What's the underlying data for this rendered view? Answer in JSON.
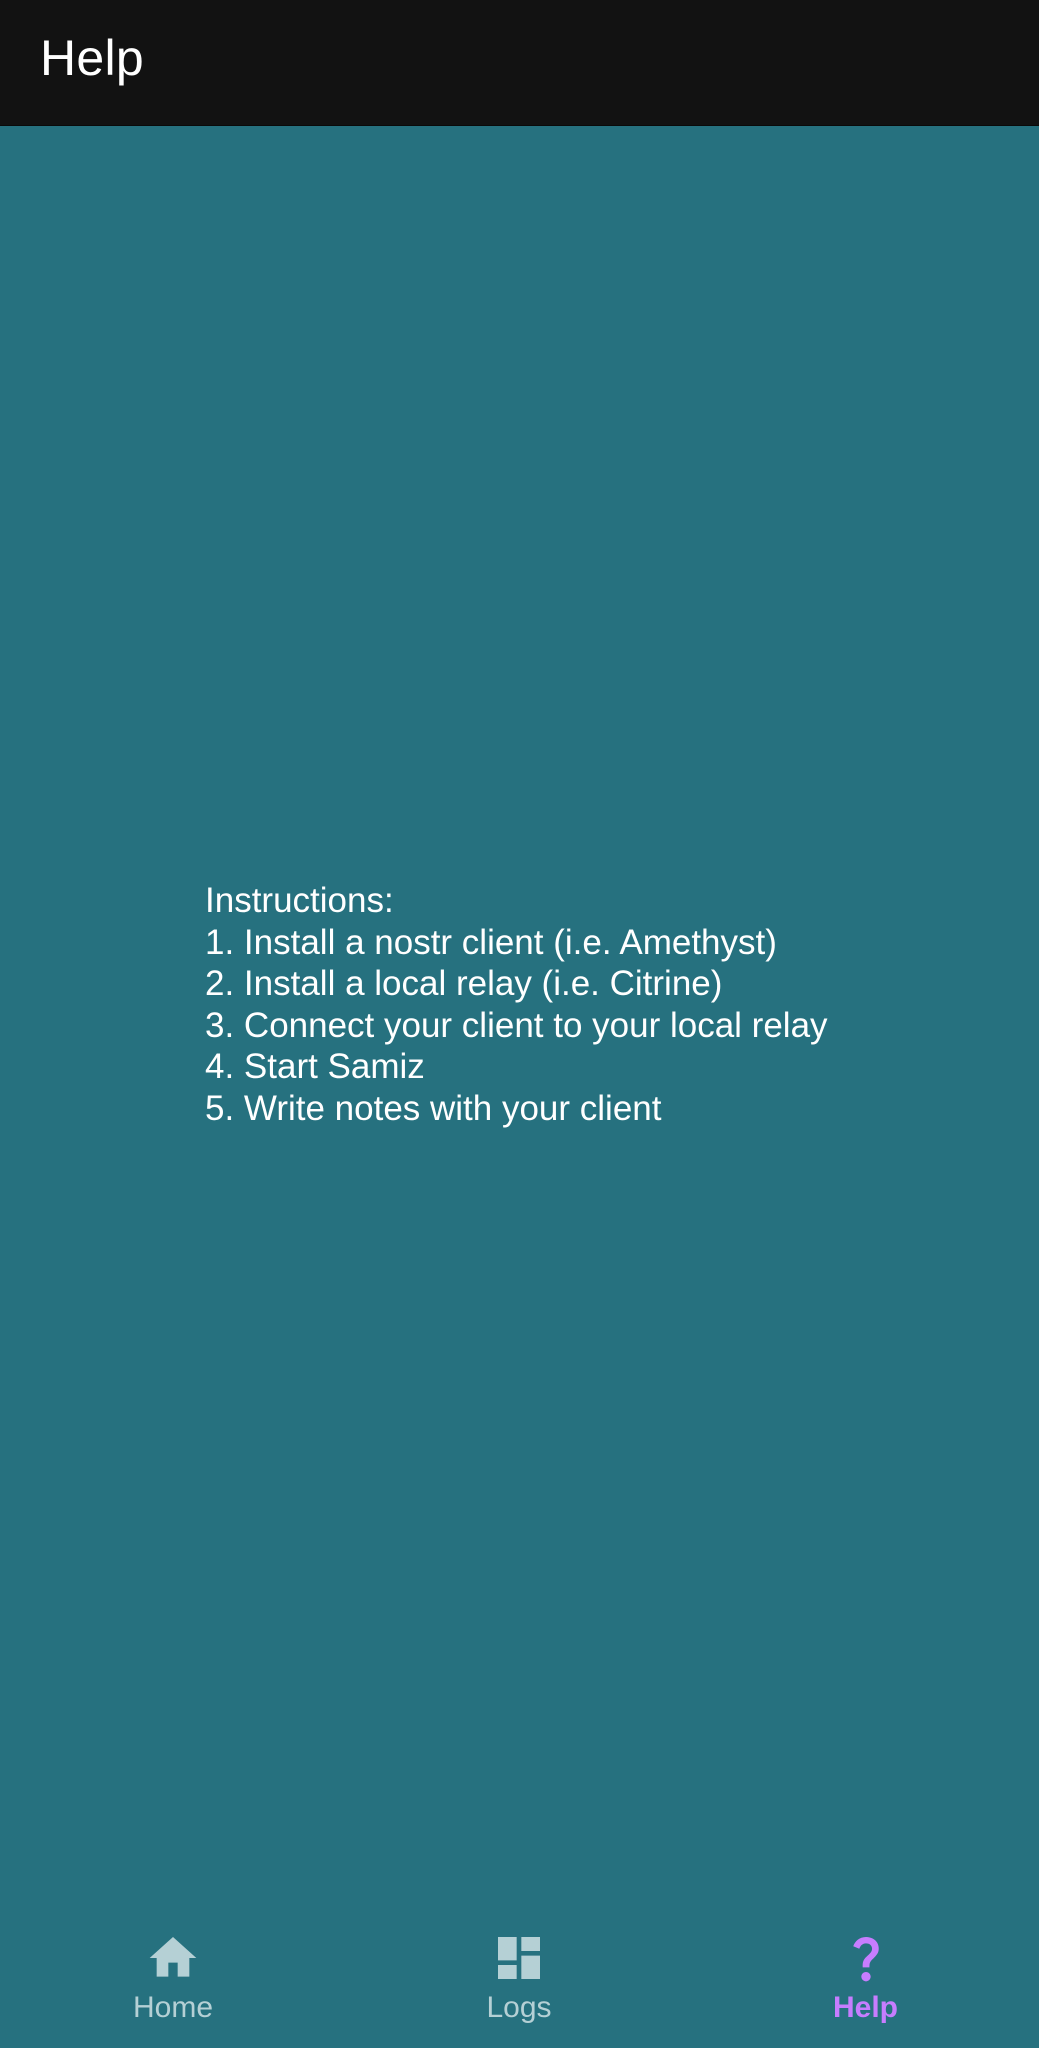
{
  "app_bar": {
    "title": "Help"
  },
  "instructions": {
    "lines": [
      "Instructions:",
      "1. Install a nostr client (i.e. Amethyst)",
      "2. Install a local relay (i.e. Citrine)",
      "3. Connect your client to your local relay",
      "4. Start Samiz",
      "5. Write notes with your client"
    ]
  },
  "bottom_nav": {
    "items": [
      {
        "label": "Home",
        "icon": "home-icon",
        "active": false
      },
      {
        "label": "Logs",
        "icon": "dashboard-icon",
        "active": false
      },
      {
        "label": "Help",
        "icon": "question-mark-icon",
        "active": true
      }
    ]
  },
  "colors": {
    "background": "#26717f",
    "app_bar": "#121212",
    "nav_inactive": "#b5d0d5",
    "nav_active": "#c77dff",
    "text": "#ffffff"
  }
}
